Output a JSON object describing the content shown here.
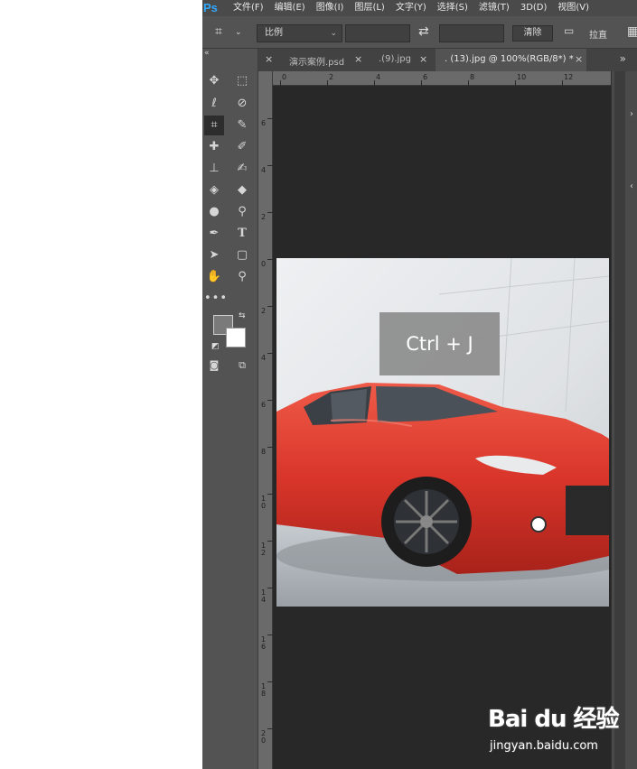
{
  "app": {
    "logo": "Ps"
  },
  "menu": [
    "文件(F)",
    "编辑(E)",
    "图像(I)",
    "图层(L)",
    "文字(Y)",
    "选择(S)",
    "滤镜(T)",
    "3D(D)",
    "视图(V)"
  ],
  "options": {
    "ratio_value": "比例",
    "clear_button": "清除",
    "straighten_label": "拉直"
  },
  "tabs": [
    {
      "label": "演示案例.psd"
    },
    {
      "label": ".(9).jpg"
    },
    {
      "label": ". (13).jpg @ 100%(RGB/8*) *",
      "active": true
    }
  ],
  "rulers": {
    "horizontal": [
      "0",
      "2",
      "4",
      "6",
      "8",
      "10",
      "12"
    ],
    "vertical": [
      "6",
      "4",
      "2",
      "0",
      "2",
      "4",
      "6",
      "8",
      "10",
      "12",
      "14",
      "16",
      "18",
      "20"
    ]
  },
  "overlay": {
    "shortcut_text": "Ctrl + J"
  },
  "colors": {
    "foreground": "#7a7a7a",
    "background": "#ffffff",
    "car": "#d9352a",
    "ps_blue": "#31a8ff"
  },
  "watermark": {
    "logo_text": "Bai du 经验",
    "url": "jingyan.baidu.com"
  }
}
